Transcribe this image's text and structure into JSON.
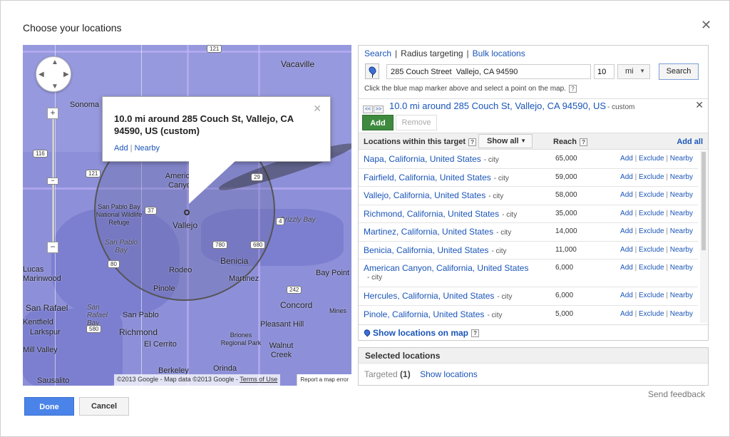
{
  "dialog": {
    "title": "Choose your locations",
    "close_glyph": "✕",
    "done_label": "Done",
    "cancel_label": "Cancel",
    "feedback_label": "Send feedback"
  },
  "map": {
    "cities": [
      {
        "label": "Vacaville"
      },
      {
        "label": "Sonoma"
      },
      {
        "label": "American Canyon"
      },
      {
        "label": "San Pablo Bay National Wildlife Refuge"
      },
      {
        "label": "San Pablo Bay"
      },
      {
        "label": "Vallejo"
      },
      {
        "label": "Grizzly Bay"
      },
      {
        "label": "Benicia"
      },
      {
        "label": "Rodeo"
      },
      {
        "label": "Martinez"
      },
      {
        "label": "Pinole"
      },
      {
        "label": "Bay Point"
      },
      {
        "label": "Lucas"
      },
      {
        "label": "Marinwood"
      },
      {
        "label": "San Rafael"
      },
      {
        "label": "San Rafael Bay"
      },
      {
        "label": "San Pablo"
      },
      {
        "label": "Concord"
      },
      {
        "label": "Richmond"
      },
      {
        "label": "Pleasant Hill"
      },
      {
        "label": "Kentfield"
      },
      {
        "label": "Larkspur"
      },
      {
        "label": "Briones Regional Park"
      },
      {
        "label": "Mill Valley"
      },
      {
        "label": "El Cerrito"
      },
      {
        "label": "Walnut Creek"
      },
      {
        "label": "Sausalito"
      },
      {
        "label": "Berkeley"
      },
      {
        "label": "Orinda"
      },
      {
        "label": "Mines"
      }
    ],
    "shields": [
      "121",
      "12",
      "116",
      "121",
      "37",
      "29",
      "780",
      "680",
      "80",
      "580",
      "242",
      "4"
    ],
    "zoom_plus": "+",
    "zoom_minus": "−",
    "infowindow": {
      "title": "10.0 mi around 285 Couch St, Vallejo, CA 94590, US (custom)",
      "add_label": "Add",
      "nearby_label": "Nearby",
      "close_glyph": "✕"
    },
    "footer_copyright": "©2013 Google - Map data ©2013 Google - ",
    "footer_terms": "Terms of Use",
    "report_label": "Report a map error"
  },
  "panel": {
    "tabs": {
      "search": "Search",
      "radius": "Radius targeting",
      "bulk": "Bulk locations"
    },
    "address_value": "285 Couch Street  Vallejo, CA 94590",
    "radius_value": "10",
    "unit_value": "mi",
    "search_label": "Search",
    "hint": "Click the blue map marker above and select a point on the map.",
    "target_nav_prev": "<<",
    "target_nav_next": ">>",
    "target_title": "10.0 mi around 285 Couch St, Vallejo, CA 94590, US",
    "target_custom": "- custom",
    "target_close": "✕",
    "add_label": "Add",
    "remove_label": "Remove",
    "list_header": {
      "locations": "Locations within this target",
      "show_all": "Show all",
      "reach": "Reach",
      "add_all": "Add all"
    },
    "rows": [
      {
        "name": "Napa, California, United States",
        "kind": "- city",
        "reach": "65,000"
      },
      {
        "name": "Fairfield, California, United States",
        "kind": "- city",
        "reach": "59,000"
      },
      {
        "name": "Vallejo, California, United States",
        "kind": "- city",
        "reach": "58,000"
      },
      {
        "name": "Richmond, California, United States",
        "kind": "- city",
        "reach": "35,000"
      },
      {
        "name": "Martinez, California, United States",
        "kind": "- city",
        "reach": "14,000"
      },
      {
        "name": "Benicia, California, United States",
        "kind": "- city",
        "reach": "11,000"
      },
      {
        "name": "American Canyon, California, United States",
        "kind": "- city",
        "reach": "6,000"
      },
      {
        "name": "Hercules, California, United States",
        "kind": "- city",
        "reach": "6,000"
      },
      {
        "name": "Pinole, California, United States",
        "kind": "- city",
        "reach": "5,000"
      }
    ],
    "row_actions": {
      "add": "Add",
      "exclude": "Exclude",
      "nearby": "Nearby",
      "sep": "|"
    },
    "show_on_map": "Show locations on map"
  },
  "selected": {
    "header": "Selected locations",
    "targeted_label": "Targeted",
    "targeted_count": "(1)",
    "show_locations": "Show locations"
  },
  "colors": {
    "accent_blue": "#1a55b8",
    "add_green": "#3e8a3e",
    "done_blue": "#4a84e8",
    "map_overlay": "#8d90d8"
  }
}
